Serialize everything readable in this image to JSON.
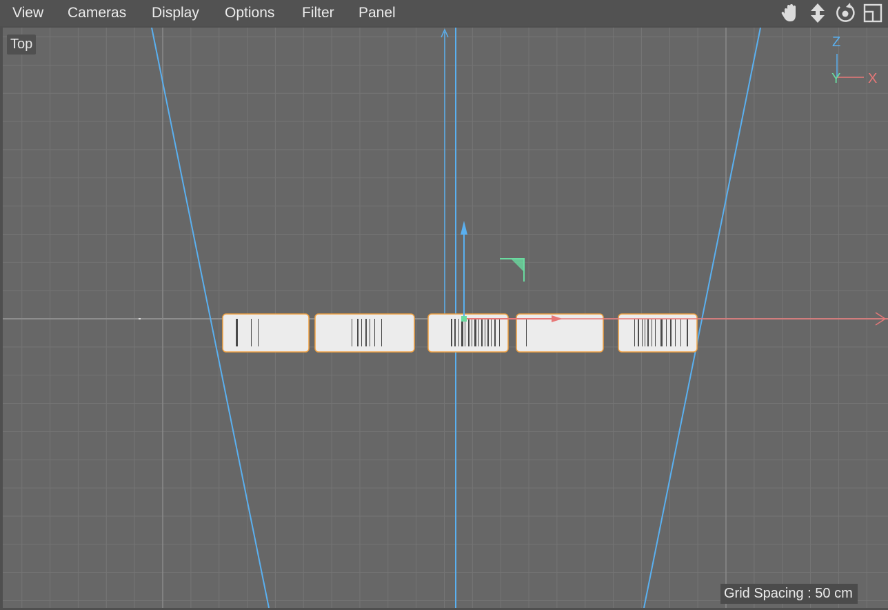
{
  "menu": [
    "View",
    "Cameras",
    "Display",
    "Options",
    "Filter",
    "Panel"
  ],
  "nav_icons": [
    "hand-pan-icon",
    "move-arrows-icon",
    "rotate-orbit-icon",
    "toggle-layout-icon"
  ],
  "viewport": {
    "view_label": "Top",
    "grid_spacing": "Grid Spacing : 50 cm"
  },
  "axis_gizmo": {
    "vertical": "Z",
    "center": "Y",
    "horizontal": "X"
  },
  "colors": {
    "background": "#676767",
    "grid_line": "#7a7a7a",
    "camera_line": "#5ab0f0",
    "x_axis": "#e87878",
    "y_axis": "#6adba0",
    "selection_outline": "#f0a040",
    "label_card": "#ececec"
  }
}
